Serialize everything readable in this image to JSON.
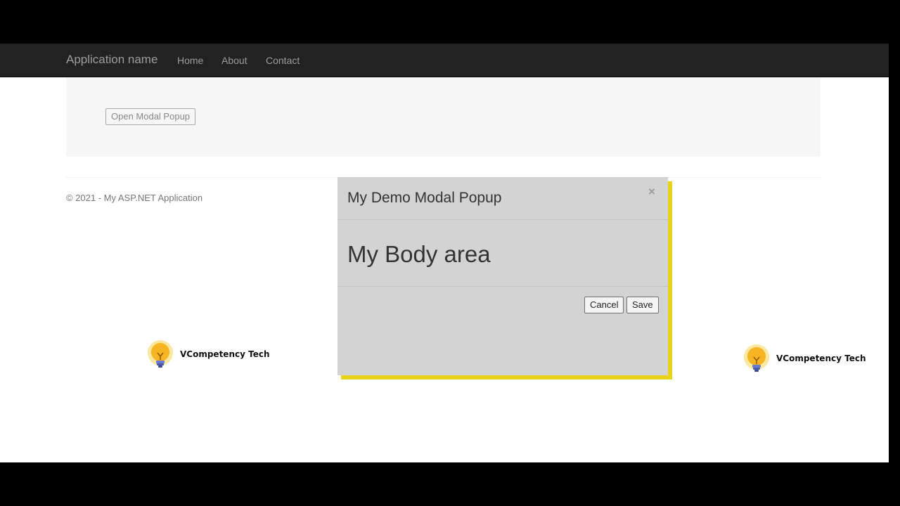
{
  "navbar": {
    "brand": "Application name",
    "links": [
      "Home",
      "About",
      "Contact"
    ]
  },
  "main": {
    "open_button_label": "Open Modal Popup"
  },
  "footer": {
    "copyright": "© 2021 - My ASP.NET Application"
  },
  "watermark": {
    "text": "VCompetency Tech",
    "icon": "lightbulb-icon"
  },
  "modal": {
    "title": "My Demo Modal Popup",
    "close_glyph": "×",
    "body": "My Body area",
    "cancel_label": "Cancel",
    "save_label": "Save",
    "accent_color": "#e8d21b",
    "background_color": "#d3d3d3"
  }
}
